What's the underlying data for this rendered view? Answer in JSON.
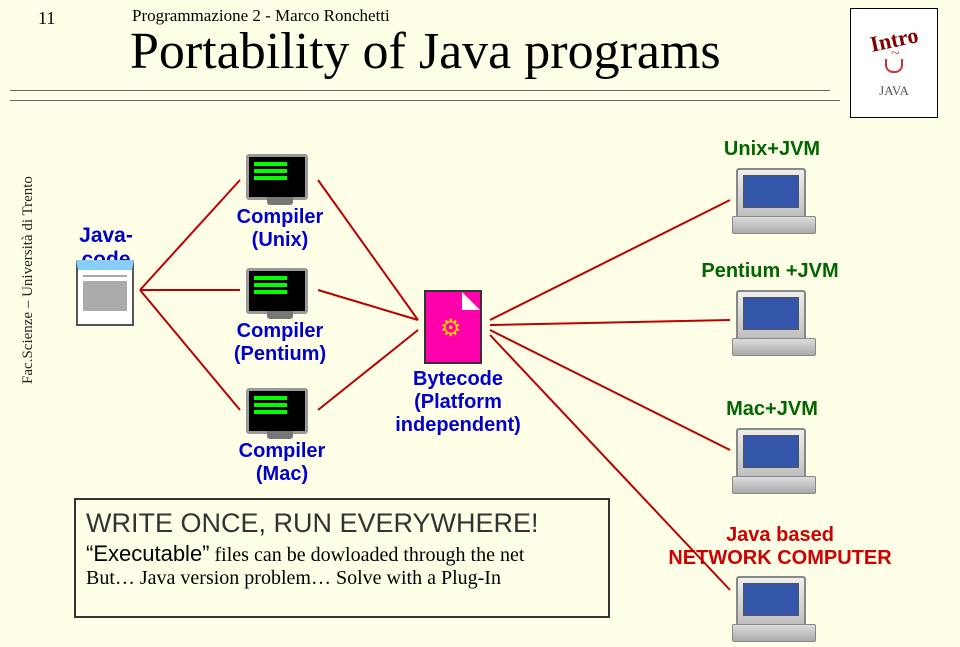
{
  "page_number": "11",
  "course": "Programmazione 2   -  Marco Ronchetti",
  "title": "Portability of Java programs",
  "sidebar_text": "Fac.Scienze – Università di Trento",
  "logo": {
    "text": "Intro",
    "subtext": "JAVA"
  },
  "nodes": {
    "java_code": "Java-code",
    "compilers": {
      "unix": "Compiler\n(Unix)",
      "pentium": "Compiler\n(Pentium)",
      "mac": "Compiler\n(Mac)"
    },
    "bytecode": "Bytecode\n(Platform\nindependent)",
    "targets": {
      "unix": "Unix+JVM",
      "pentium": "Pentium +JVM",
      "mac": "Mac+JVM",
      "network": "Java based\nNETWORK COMPUTER"
    }
  },
  "bottom_box": {
    "headline": "WRITE ONCE, RUN EVERYWHERE!",
    "line2a": "“Executable”",
    "line2b": " files can be dowloaded through the net",
    "line3": "But… Java version problem… Solve with a Plug-In"
  }
}
